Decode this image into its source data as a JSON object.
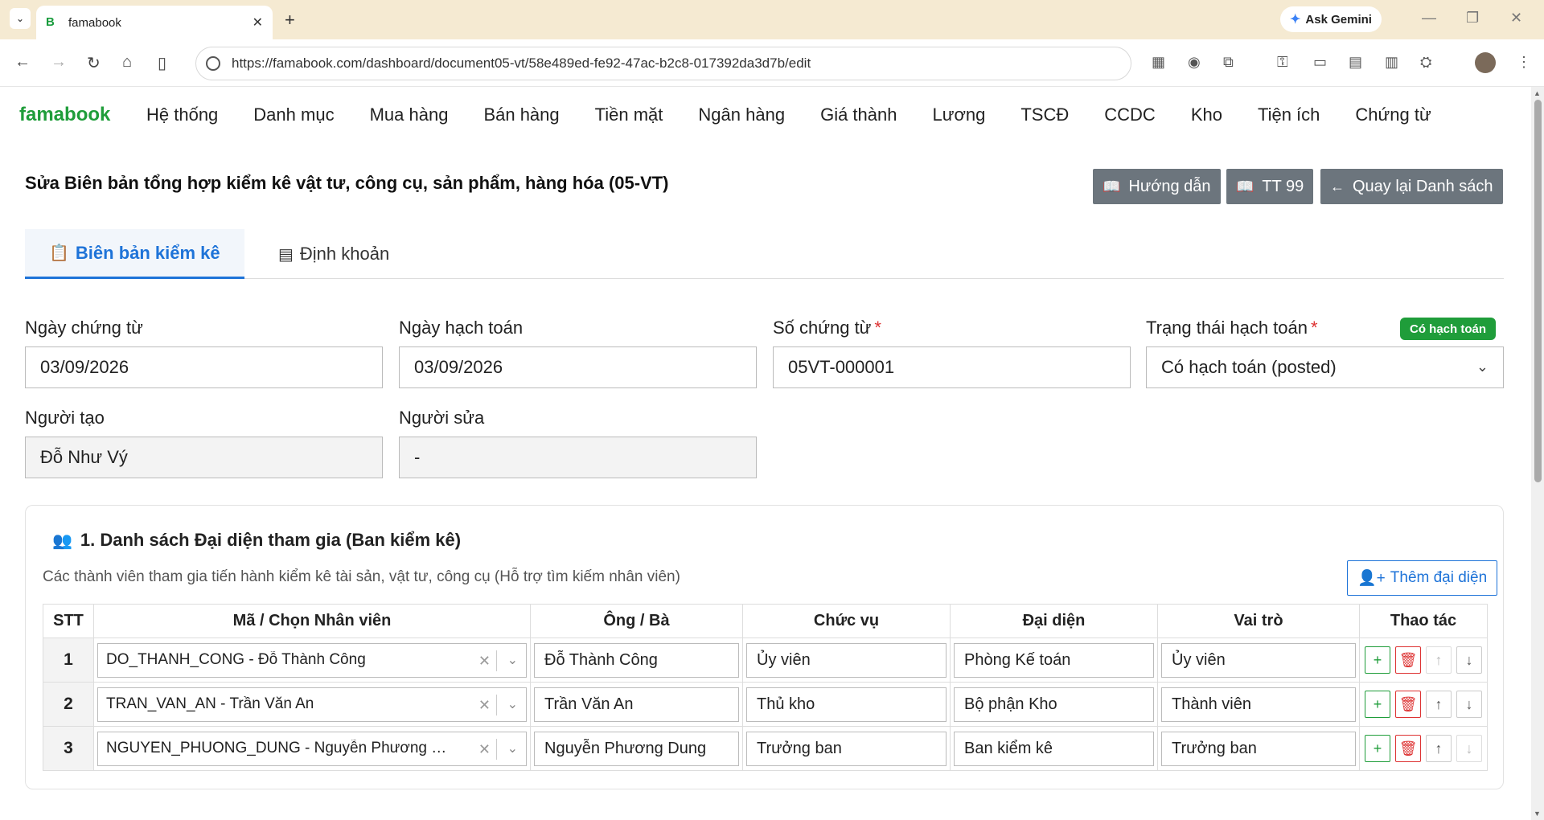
{
  "browser": {
    "tab_title": "famabook",
    "tab_favicon": "B",
    "url": "https://famabook.com/dashboard/document05-vt/58e489ed-fe92-47ac-b2c8-017392da3d7b/edit",
    "gemini_label": "Ask Gemini"
  },
  "app": {
    "brand": "famabook",
    "menu": [
      "Hệ thống",
      "Danh mục",
      "Mua hàng",
      "Bán hàng",
      "Tiền mặt",
      "Ngân hàng",
      "Giá thành",
      "Lương",
      "TSCĐ",
      "CCDC",
      "Kho",
      "Tiện ích",
      "Chứng từ"
    ]
  },
  "page": {
    "title": "Sửa Biên bản tổng hợp kiểm kê vật tư, công cụ, sản phẩm, hàng hóa (05-VT)",
    "btn_guide": "Hướng dẫn",
    "btn_tt": "TT 99",
    "btn_back": "Quay lại Danh sách",
    "tabs": [
      "Biên bản kiểm kê",
      "Định khoản"
    ]
  },
  "form": {
    "ngay_chung_tu_label": "Ngày chứng từ",
    "ngay_chung_tu": "03/09/2026",
    "ngay_hach_toan_label": "Ngày hạch toán",
    "ngay_hach_toan": "03/09/2026",
    "so_chung_tu_label": "Số chứng từ",
    "so_chung_tu": "05VT-000001",
    "trang_thai_label": "Trạng thái hạch toán",
    "trang_thai": "Có hạch toán (posted)",
    "trang_thai_badge": "Có hạch toán",
    "nguoi_tao_label": "Người tạo",
    "nguoi_tao": "Đỗ Như Vý",
    "nguoi_sua_label": "Người sửa",
    "nguoi_sua": "-",
    "required_mark": "*"
  },
  "section": {
    "title": "1. Danh sách Đại diện tham gia (Ban kiểm kê)",
    "desc": "Các thành viên tham gia tiến hành kiểm kê tài sản, vật tư, công cụ (Hỗ trợ tìm kiếm nhân viên)",
    "add_btn": "Thêm đại diện",
    "headers": [
      "STT",
      "Mã / Chọn Nhân viên",
      "Ông / Bà",
      "Chức vụ",
      "Đại diện",
      "Vai trò",
      "Thao tác"
    ],
    "rows": [
      {
        "stt": "1",
        "nhan_vien": "DO_THANH_CONG - Đỗ Thành Công",
        "ong_ba": "Đỗ Thành Công",
        "chuc_vu": "Ủy viên",
        "dai_dien": "Phòng Kế toán",
        "vai_tro": "Ủy viên"
      },
      {
        "stt": "2",
        "nhan_vien": "TRAN_VAN_AN - Trần Văn An",
        "ong_ba": "Trần Văn An",
        "chuc_vu": "Thủ kho",
        "dai_dien": "Bộ phận Kho",
        "vai_tro": "Thành viên"
      },
      {
        "stt": "3",
        "nhan_vien": "NGUYEN_PHUONG_DUNG - Nguyễn Phương …",
        "ong_ba": "Nguyễn Phương Dung",
        "chuc_vu": "Trưởng ban",
        "dai_dien": "Ban kiểm kê",
        "vai_tro": "Trưởng ban"
      }
    ]
  },
  "colors": {
    "brand": "#1f9d3a",
    "accent": "#1e73d8",
    "button_gray": "#6c757d",
    "danger": "#dd3333"
  }
}
